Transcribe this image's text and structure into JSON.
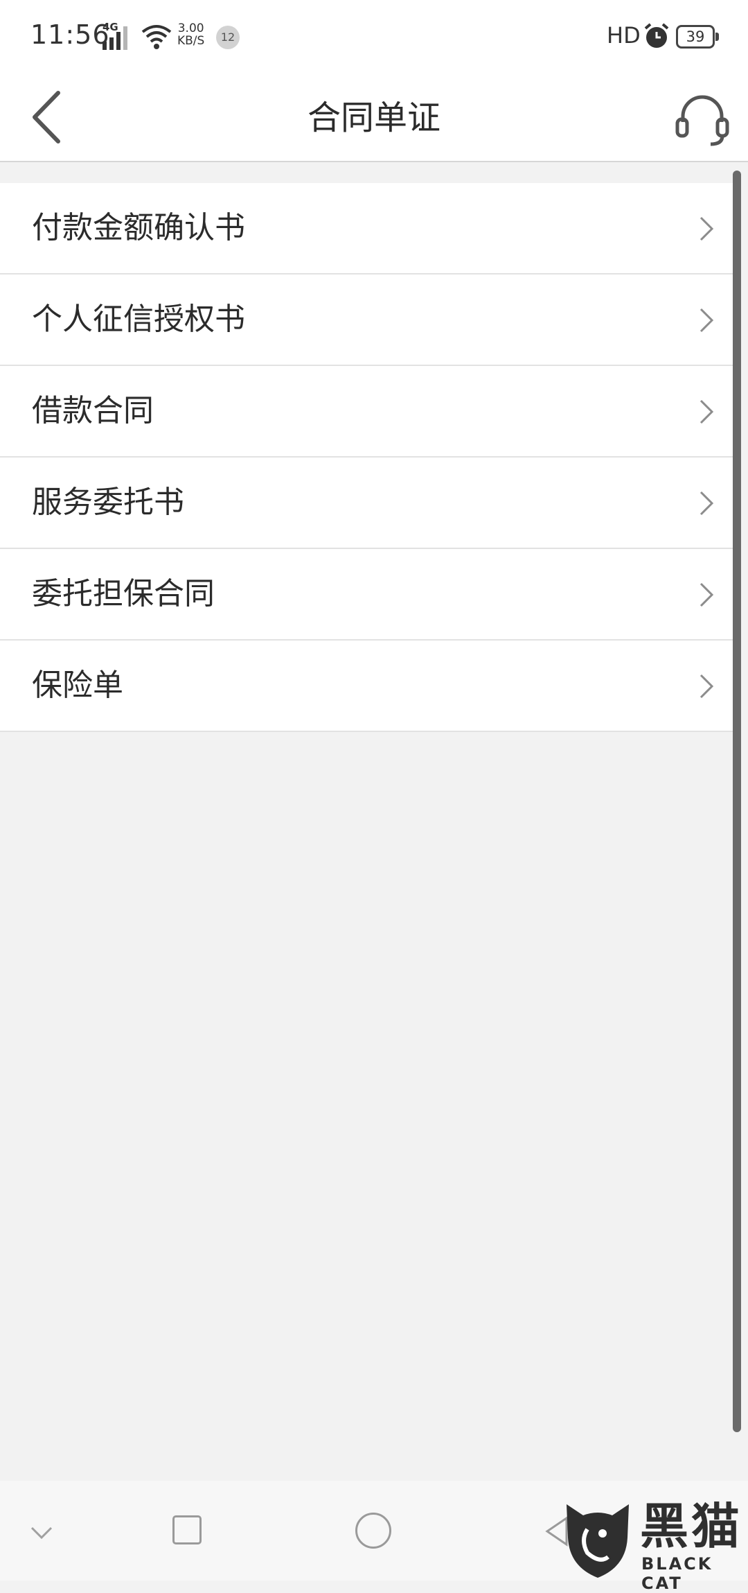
{
  "status_bar": {
    "time": "11:56",
    "network": "4G",
    "speed_value": "3.00",
    "speed_unit": "KB/S",
    "notification_count": "12",
    "hd": "HD",
    "battery": "39"
  },
  "header": {
    "title": "合同单证",
    "back_icon": "chevron-left-icon",
    "service_icon": "headset-icon"
  },
  "documents": [
    {
      "label": "付款金额确认书"
    },
    {
      "label": "个人征信授权书"
    },
    {
      "label": "借款合同"
    },
    {
      "label": "服务委托书"
    },
    {
      "label": "委托担保合同"
    },
    {
      "label": "保险单"
    }
  ],
  "nav_bar": {
    "icons": [
      "chevron-down-icon",
      "square-icon",
      "circle-icon",
      "triangle-back-icon"
    ]
  },
  "watermark": {
    "cn": "黑猫",
    "en": "BLACK CAT"
  }
}
